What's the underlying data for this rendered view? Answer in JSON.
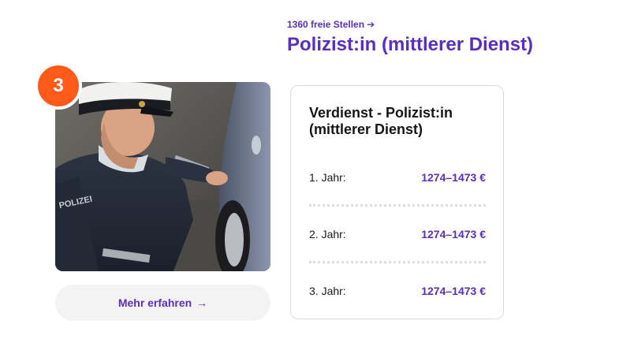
{
  "badge": {
    "number": "3"
  },
  "photo": {
    "alt": "Polizist untersucht Fahrzeugreifen",
    "jacket_text": "POLIZEI"
  },
  "more_button": {
    "label": "Mehr erfahren",
    "arrow": "→"
  },
  "job": {
    "openings_link": "1360 freie Stellen",
    "openings_arrow": "➔",
    "title": "Polizist:in (mittlerer Dienst)"
  },
  "salary": {
    "title": "Verdienst - Polizist:in (mittlerer Dienst)",
    "rows": [
      {
        "label": "1. Jahr:",
        "value": "1274–1473 €"
      },
      {
        "label": "2. Jahr:",
        "value": "1274–1473 €"
      },
      {
        "label": "3. Jahr:",
        "value": "1274–1473 €"
      }
    ]
  },
  "colors": {
    "accent": "#5a2fbf",
    "badge": "#ff5a1a",
    "button_bg": "#f3f3f3",
    "border": "#dcdcdc"
  }
}
